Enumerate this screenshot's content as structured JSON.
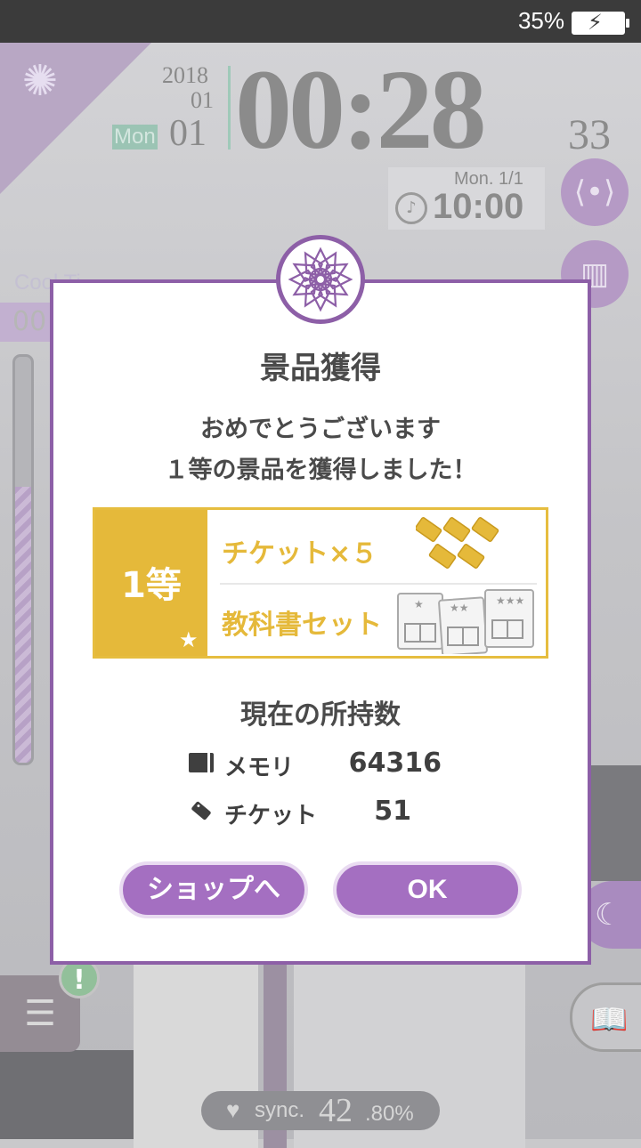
{
  "status_bar": {
    "battery_percent": "35%",
    "battery_icon": "battery-charging-icon"
  },
  "clock": {
    "year": "2018",
    "month": "01",
    "weekday": "Mon",
    "day": "01",
    "time": "00:28",
    "seconds": "33"
  },
  "alarm": {
    "date": "Mon.  1/1",
    "time": "10:00",
    "icon": "bell-icon"
  },
  "side_buttons": {
    "share_icon": "share-icon",
    "library_icon": "library-icon",
    "moon_icon": "moon-icon",
    "book_icon": "book-icon",
    "menu_icon": "menu-icon"
  },
  "cooltime": {
    "label": "Cool Ti",
    "value": "00"
  },
  "alert": {
    "badge": "!"
  },
  "sync": {
    "label": "sync.",
    "value": "42",
    "decimal": ".80%"
  },
  "modal": {
    "emblem_icon": "flower-emblem-icon",
    "title": "景品獲得",
    "message_line1": "おめでとうございます",
    "message_line2": "１等の景品を獲得しました！",
    "prize": {
      "rank": "1等",
      "star": "★",
      "items": [
        "チケット×５",
        "教科書セット"
      ],
      "icons": [
        "ticket-stack-icon",
        "textbook-set-icon"
      ]
    },
    "holdings_title": "現在の所持数",
    "holdings": [
      {
        "icon": "memory-card-icon",
        "label": "メモリ",
        "value": "64316"
      },
      {
        "icon": "ticket-icon",
        "label": "チケット",
        "value": "51"
      }
    ],
    "buttons": {
      "shop": "ショップへ",
      "ok": "OK"
    }
  },
  "colors": {
    "accent_purple": "#a46fc1",
    "border_purple": "#8d5fa7",
    "prize_gold": "#e5b93a"
  }
}
